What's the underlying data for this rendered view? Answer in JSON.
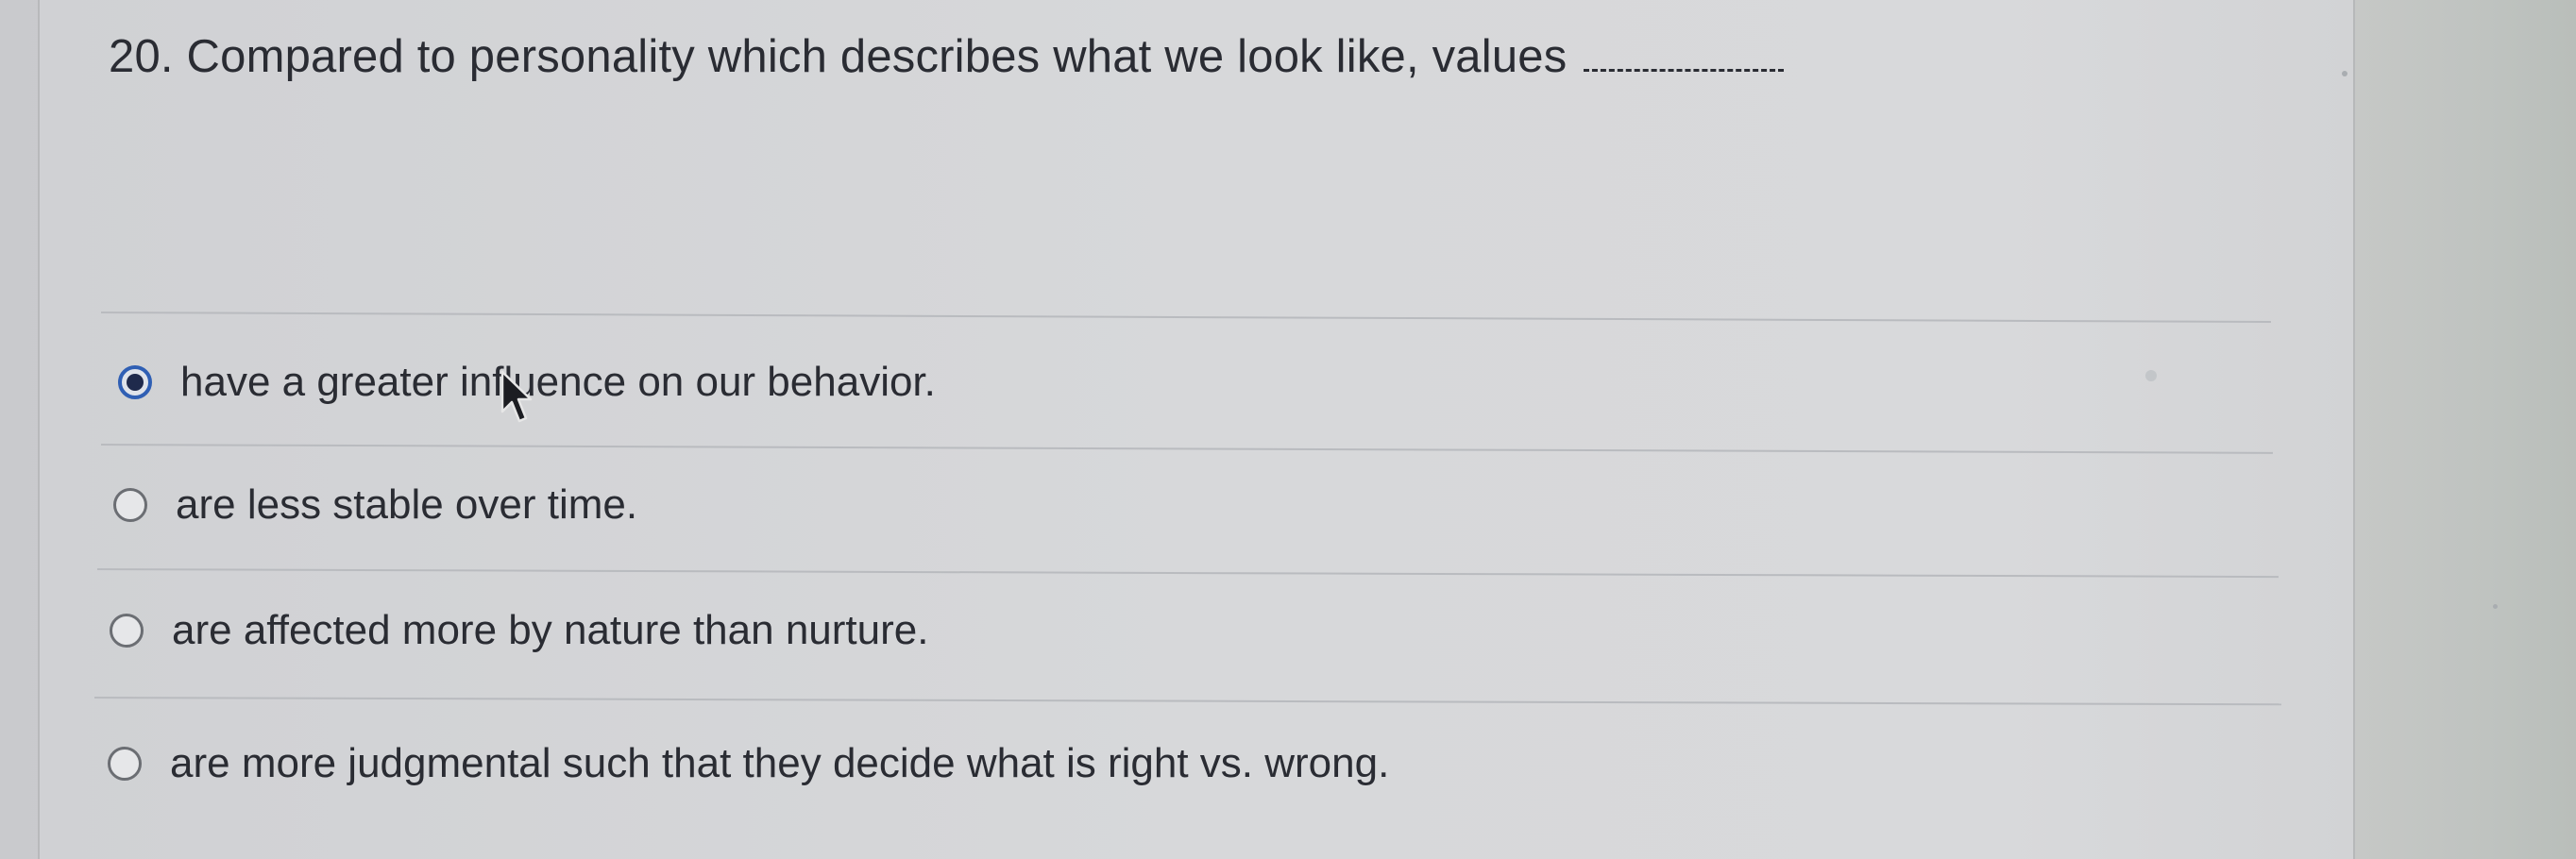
{
  "question": {
    "text": "20. Compared to personality which describes what we look like, values"
  },
  "options": [
    {
      "label": "have a greater influence on our behavior.",
      "selected": true
    },
    {
      "label": "are less stable over time.",
      "selected": false
    },
    {
      "label": "are affected more by nature than nurture.",
      "selected": false
    },
    {
      "label": "are more judgmental such that they decide what is right vs. wrong.",
      "selected": false
    }
  ],
  "colors": {
    "selected_radio": "#2f5fb4",
    "text": "#2a2c33",
    "divider": "#b9bbbf"
  },
  "icons": {
    "pointer": "mouse-pointer-icon",
    "radio_selected": "radio-selected-icon",
    "radio_empty": "radio-empty-icon"
  }
}
